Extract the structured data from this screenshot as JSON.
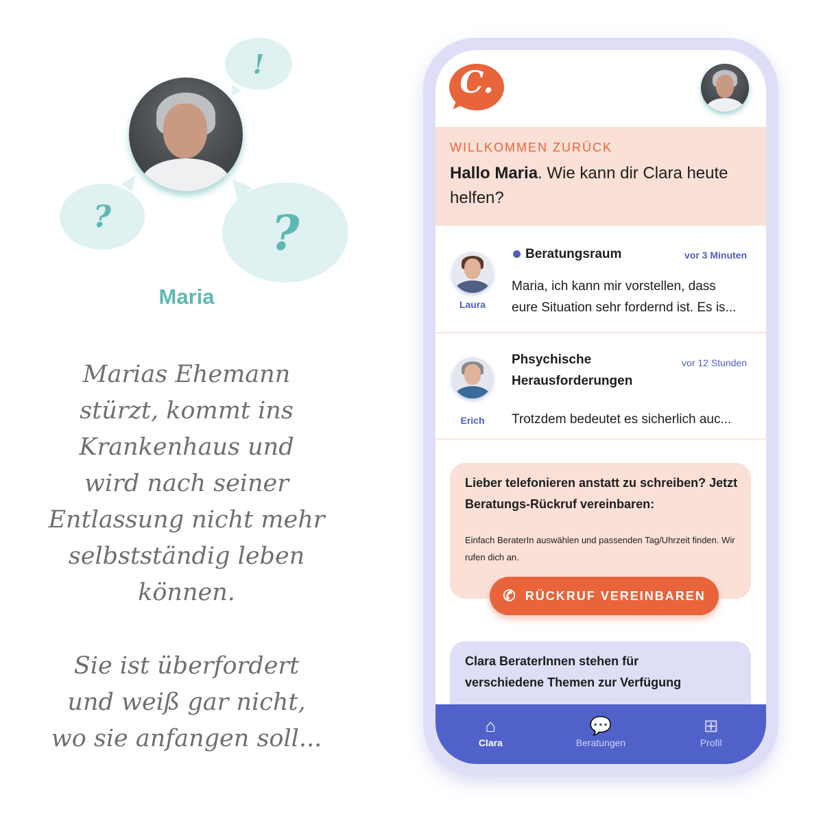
{
  "story": {
    "bubbles": {
      "exclamation": "!",
      "question_small": "?",
      "question_large": "?"
    },
    "persona_name": "Maria",
    "text_part1": "Marias Ehemann stürzt, kommt ins Krankenhaus und wird nach seiner Entlassung nicht mehr selbstständig leben können.",
    "text_part2": "Sie ist überfordert und weiß gar nicht, wo sie anfangen soll..."
  },
  "app": {
    "logo_letter": "C.",
    "welcome": {
      "kicker": "WILLKOMMEN ZURÜCK",
      "greeting_bold": "Hallo Maria",
      "greeting_rest": ". Wie kann dir Clara heute helfen?"
    },
    "conversations": [
      {
        "advisor": "Laura",
        "title": "Beratungsraum",
        "time": "vor 3 Minuten",
        "unread": true,
        "message": "Maria, ich kann mir vorstellen, dass eure Situation sehr fordernd ist. Es is..."
      },
      {
        "advisor": "Erich",
        "title": "Phsychische Herausforderungen",
        "time": "vor 12 Stunden",
        "unread": false,
        "message": "Trotzdem bedeutet es sicherlich auc..."
      }
    ],
    "callback": {
      "title": "Lieber telefonieren anstatt zu schreiben? Jetzt Beratungs-Rückruf vereinbaren:",
      "description": "Einfach BeraterIn auswählen und passenden Tag/Uhrzeit finden. Wir rufen dich an.",
      "button_label": "RÜCKRUF VEREINBAREN",
      "button_icon": "phone-callback-icon"
    },
    "topics": {
      "title": "Clara BeraterInnen stehen für verschiedene Themen zur Verfügung"
    },
    "tabs": [
      {
        "label": "Clara",
        "icon": "home-icon",
        "active": true
      },
      {
        "label": "Beratungen",
        "icon": "chat-bubbles-icon",
        "active": false
      },
      {
        "label": "Profil",
        "icon": "clipboard-plus-icon",
        "active": false
      }
    ]
  },
  "colors": {
    "teal": "#5eb8b4",
    "bubble": "#dff1f1",
    "orange": "#e8643a",
    "peach": "#fbe0d7",
    "indigo": "#5061c9",
    "lavender": "#dedff7"
  }
}
